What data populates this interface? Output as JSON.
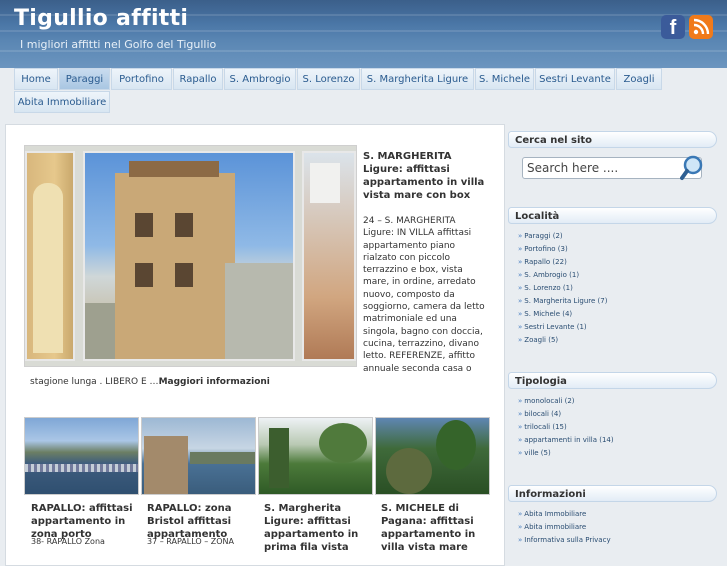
{
  "site": {
    "title": "Tigullio affitti",
    "tagline": "I migliori affitti nel Golfo del Tigullio"
  },
  "social": {
    "facebook_icon": "facebook-icon",
    "rss_icon": "rss-icon",
    "facebook_letter": "f"
  },
  "nav": {
    "items": [
      {
        "label": "Home"
      },
      {
        "label": "Paraggi"
      },
      {
        "label": "Portofino"
      },
      {
        "label": "Rapallo"
      },
      {
        "label": "S. Ambrogio"
      },
      {
        "label": "S. Lorenzo"
      },
      {
        "label": "S. Margherita Ligure"
      },
      {
        "label": "S. Michele"
      },
      {
        "label": "Sestri Levante"
      },
      {
        "label": "Zoagli"
      },
      {
        "label": "Abita Immobiliare"
      }
    ],
    "active_label": "Paraggi"
  },
  "featured": {
    "title": "S. MARGHERITA Ligure: affittasi appartamento in villa vista mare con box",
    "excerpt": "24 – S. MARGHERITA Ligure: IN VILLA affittasi appartamento piano rialzato con piccolo terrazzino e box, vista mare, in ordine, arredato nuovo, composto da soggiorno, camera da letto matrimoniale ed una singola, bagno con doccia, cucina, terrazzino, divano letto. REFERENZE, affitto annuale seconda casa o",
    "excerpt_tail": "stagione lunga . LIBERO E …",
    "more_label": "Maggiori informazioni"
  },
  "posts": [
    {
      "title": "RAPALLO: affittasi appartamento in zona porto",
      "excerpt": "38- RAPALLO Zona"
    },
    {
      "title": "RAPALLO: zona Bristol affittasi appartamento",
      "excerpt": "37 – RAPALLO – ZONA"
    },
    {
      "title": "S. Margherita Ligure: affittasi appartamento in prima fila vista",
      "excerpt": ""
    },
    {
      "title": "S. MICHELE di Pagana: affittasi appartamento in villa vista mare",
      "excerpt": ""
    }
  ],
  "sidebar": {
    "search": {
      "title": "Cerca nel sito",
      "placeholder": "Search here ....",
      "icon": "magnifier-icon"
    },
    "localita": {
      "title": "Località",
      "items": [
        {
          "label": "Paraggi (2)"
        },
        {
          "label": "Portofino (3)"
        },
        {
          "label": "Rapallo (22)"
        },
        {
          "label": "S. Ambrogio (1)"
        },
        {
          "label": "S. Lorenzo (1)"
        },
        {
          "label": "S. Margherita Ligure (7)"
        },
        {
          "label": "S. Michele (4)"
        },
        {
          "label": "Sestri Levante (1)"
        },
        {
          "label": "Zoagli (5)"
        }
      ]
    },
    "tipologia": {
      "title": "Tipologia",
      "items": [
        {
          "label": "monolocali (2)"
        },
        {
          "label": "bilocali (4)"
        },
        {
          "label": "trilocali (15)"
        },
        {
          "label": "appartamenti in villa (14)"
        },
        {
          "label": "ville (5)"
        }
      ]
    },
    "informazioni": {
      "title": "Informazioni",
      "items": [
        {
          "label": "Abita Immobiliare"
        },
        {
          "label": "Abita immobiliare"
        },
        {
          "label": "Informativa sulla Privacy"
        }
      ]
    },
    "bullet": "»"
  },
  "colors": {
    "header_sea": "#4a76a6",
    "nav_text": "#2a5b8f",
    "link": "#2a4d72",
    "facebook": "#3b5b9a",
    "rss": "#f07a1a"
  }
}
